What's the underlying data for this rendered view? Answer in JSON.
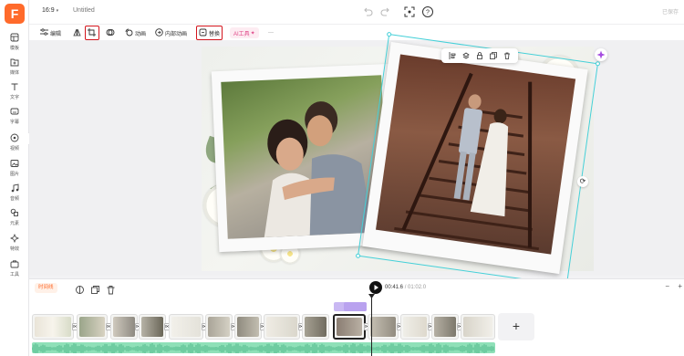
{
  "app": {
    "logo_letter": "F",
    "accent": "#ff6a2b"
  },
  "sidebar": {
    "items": [
      {
        "label": "模板",
        "icon": "template-icon"
      },
      {
        "label": "媒体",
        "icon": "media-icon"
      },
      {
        "label": "文字",
        "icon": "text-icon"
      },
      {
        "label": "字幕",
        "icon": "subtitle-icon"
      },
      {
        "label": "视频",
        "icon": "video-icon"
      },
      {
        "label": "图片",
        "icon": "image-icon"
      },
      {
        "label": "音频",
        "icon": "audio-icon"
      },
      {
        "label": "元素",
        "icon": "elements-icon"
      },
      {
        "label": "特效",
        "icon": "effects-icon"
      },
      {
        "label": "工具",
        "icon": "tools-icon"
      }
    ]
  },
  "header": {
    "ratio": "16:9",
    "title": "Untitled",
    "save_state": "已保存"
  },
  "toolbar": {
    "edit": "编辑",
    "crop_tooltip": "裁剪",
    "animation": "动画",
    "inner_animation": "内部动画",
    "replace": "替换",
    "ai_tools": "AI工具",
    "more": "···",
    "highlight_color": "#d3151d"
  },
  "timeline": {
    "label": "时间线",
    "current_time": "00:41.6",
    "separator": " / ",
    "total_time": "01:02.0",
    "add_label": "+",
    "zoom_out": "−",
    "zoom_in": "+"
  },
  "canvas": {
    "selection_color": "#45d0d8"
  }
}
